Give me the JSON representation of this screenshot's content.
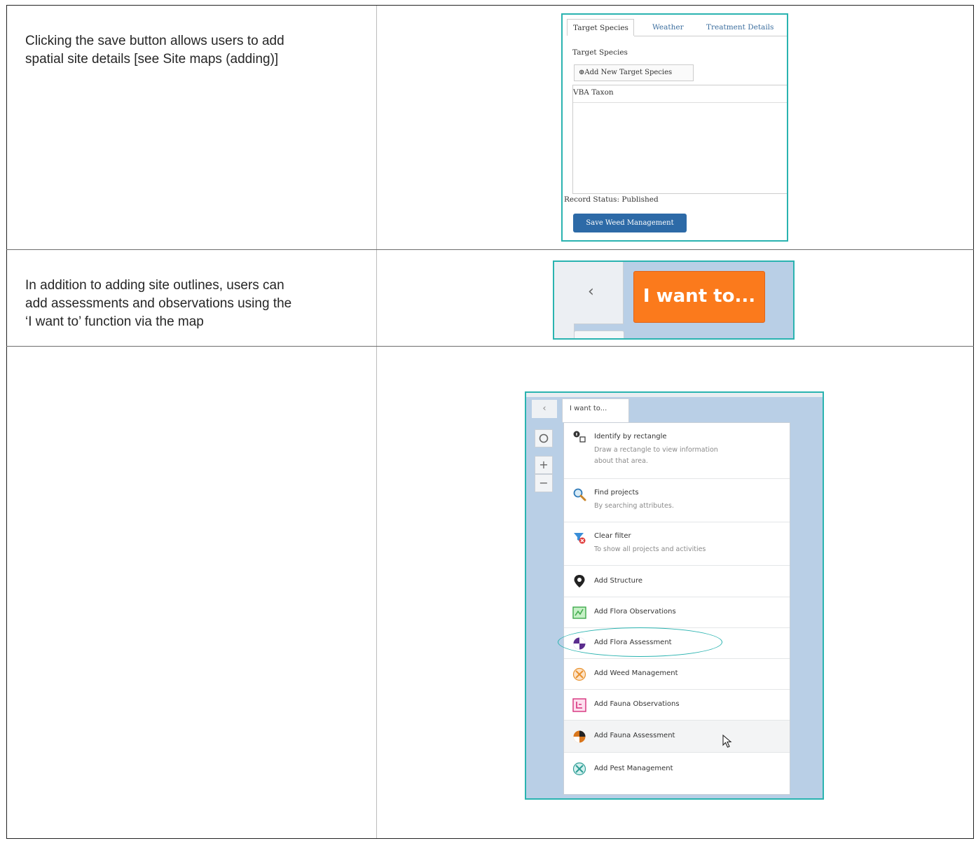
{
  "rows": [
    {
      "text_lines": [
        "Clicking the save button allows users to add",
        "spatial site details [see Site maps (adding)]"
      ]
    },
    {
      "text_lines": [
        "In addition to adding site outlines, users can",
        "add assessments and observations using the",
        "‘I want to’ function via the map"
      ]
    }
  ],
  "screenshot1": {
    "tabs": [
      "Target Species",
      "Weather",
      "Treatment Details"
    ],
    "section_label": "Target Species",
    "add_button": "⊕Add New Target Species",
    "column_header": "VBA Taxon",
    "record_status": "Record Status: Published",
    "save_button": "Save Weed Management"
  },
  "screenshot2": {
    "back_glyph": "‹",
    "i_want_to_button": "I want to..."
  },
  "screenshot3": {
    "back_glyph": "‹",
    "tab_label": "I want to...",
    "controls": [
      "◯",
      "+",
      "−"
    ],
    "menu_items": [
      {
        "title": "Identify by rectangle",
        "subtitle_lines": [
          "Draw a rectangle to view information",
          "about that area."
        ],
        "icon": "identify-icon"
      },
      {
        "title": "Find projects",
        "subtitle_lines": [
          "By searching attributes."
        ],
        "icon": "magnifier-icon"
      },
      {
        "title": "Clear filter",
        "subtitle_lines": [
          "To show all projects and activities"
        ],
        "icon": "clear-filter-icon"
      },
      {
        "title": "Add Structure",
        "subtitle_lines": [],
        "icon": "map-pin-icon"
      },
      {
        "title": "Add Flora Observations",
        "subtitle_lines": [],
        "icon": "flora-observation-icon"
      },
      {
        "title": "Add Flora Assessment",
        "subtitle_lines": [],
        "icon": "flora-assessment-icon"
      },
      {
        "title": "Add Weed Management",
        "subtitle_lines": [],
        "icon": "weed-management-icon"
      },
      {
        "title": "Add Fauna Observations",
        "subtitle_lines": [],
        "icon": "fauna-observation-icon"
      },
      {
        "title": "Add Fauna Assessment",
        "subtitle_lines": [],
        "icon": "fauna-assessment-icon"
      },
      {
        "title": "Add Pest Management",
        "subtitle_lines": [],
        "icon": "pest-management-icon"
      }
    ],
    "highlighted_item": "Add Flora Assessment",
    "hovered_item": "Add Fauna Assessment"
  },
  "colors": {
    "highlight": "#2ab3b0",
    "orange_button": "#fb7a1c",
    "save_button": "#2d6aa7",
    "map_background": "#b9cfe6"
  }
}
